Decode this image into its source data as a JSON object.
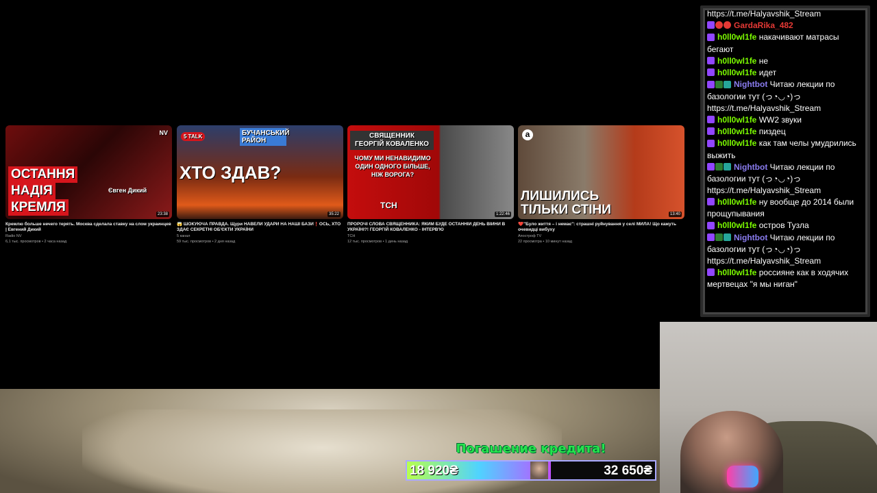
{
  "videos": [
    {
      "thumb_lines": [
        "ОСТАННЯ",
        "НАДІЯ",
        "КРЕМЛЯ"
      ],
      "thumb_badge": "NV",
      "thumb_name": "Євген Дикий",
      "duration": "23:38",
      "title": "Кремлю больше нечего терять. Москва сделала ставку на слом украинцев | Евгений Дикий",
      "channel": "Radio NV",
      "meta": "6,1 тыс. просмотров • 2 часа назад"
    },
    {
      "thumb_lines": [
        "ХТО ЗДАВ?"
      ],
      "thumb_badge": "5 TALK",
      "thumb_name": "БУЧАНСЬКИЙ РАЙОН",
      "duration": "35:22",
      "title": "😱 ШОКУЮЧА ПРАВДА. Щури НАВЕЛИ УДАРИ НА НАШІ БАЗИ❗ОСЬ, ХТО ЗДАЄ СЕКРЕТНІ ОБ'ЄКТИ УКРАЇНИ",
      "channel": "5 канал",
      "meta": "59 тыс. просмотров • 2 дня назад"
    },
    {
      "thumb_lines": [
        "СВЯЩЕННИК",
        "ГЕОРГІЙ КОВАЛЕНКО"
      ],
      "thumb_quote": "ЧОМУ МИ НЕНАВИДИМО ОДИН ОДНОГО БІЛЬШЕ, НІЖ ВОРОГА?",
      "thumb_badge": "ТСН",
      "duration": "1:22:46",
      "title": "ПРОРОЧІ СЛОВА СВЯЩЕННИКА: ЯКИМ БУДЕ ОСТАННІЙ ДЕНЬ ВІЙНИ В УКРАЇНІ?! ГЕОРГІЙ КОВАЛЕНКО - ІНТЕРВ'Ю",
      "channel": "ТСН",
      "meta": "12 тыс. просмотров • 1 день назад"
    },
    {
      "thumb_lines": [
        "ЛИШИЛИСЬ",
        "ТІЛЬКИ СТІНИ"
      ],
      "thumb_badge": "a",
      "duration": "13:40",
      "title": "❤️\"Було життя – і немає\": страшні руйнування у селі МИЛА! Що кажуть очевидці вибуху",
      "channel": "Апостроф TV",
      "meta": "22 просмотра • 10 минут назад"
    }
  ],
  "chat": [
    {
      "name": "",
      "text": "https://t.me/Halyavshik_Stream",
      "color": "white",
      "badges": []
    },
    {
      "name": "GardaRika_482",
      "text": "",
      "color": "red",
      "badges": [
        "twitch",
        "red",
        "red"
      ]
    },
    {
      "name": "h0ll0wl1fe",
      "text": "накачивают матрасы бегают",
      "color": "green",
      "badges": [
        "twitch"
      ]
    },
    {
      "name": "h0ll0wl1fe",
      "text": "не",
      "color": "green",
      "badges": [
        "twitch"
      ]
    },
    {
      "name": "h0ll0wl1fe",
      "text": "идет",
      "color": "green",
      "badges": [
        "twitch"
      ]
    },
    {
      "name": "Nightbot",
      "text": "Читаю лекции по базологии тут (っ◔◡◔)っ https://t.me/Halyavshik_Stream",
      "color": "purple",
      "badges": [
        "twitch",
        "green",
        "teal"
      ]
    },
    {
      "name": "h0ll0wl1fe",
      "text": "WW2 звуки",
      "color": "green",
      "badges": [
        "twitch"
      ]
    },
    {
      "name": "h0ll0wl1fe",
      "text": "пиздец",
      "color": "green",
      "badges": [
        "twitch"
      ]
    },
    {
      "name": "h0ll0wl1fe",
      "text": "как там челы умудрились выжить",
      "color": "green",
      "badges": [
        "twitch"
      ]
    },
    {
      "name": "Nightbot",
      "text": "Читаю лекции по базологии тут (っ◔◡◔)っ https://t.me/Halyavshik_Stream",
      "color": "purple",
      "badges": [
        "twitch",
        "green",
        "teal"
      ]
    },
    {
      "name": "h0ll0wl1fe",
      "text": "ну вообще до 2014 были прощупывания",
      "color": "green",
      "badges": [
        "twitch"
      ]
    },
    {
      "name": "h0ll0wl1fe",
      "text": "остров Тузла",
      "color": "green",
      "badges": [
        "twitch"
      ]
    },
    {
      "name": "Nightbot",
      "text": "Читаю лекции по базологии тут (っ◔◡◔)っ https://t.me/Halyavshik_Stream",
      "color": "purple",
      "badges": [
        "twitch",
        "green",
        "teal"
      ]
    },
    {
      "name": "h0ll0wl1fe",
      "text": "россияне как в ходячих мертвецах \"я мы ниган\"",
      "color": "green",
      "badges": [
        "twitch"
      ]
    }
  ],
  "goal": {
    "title": "Погашение кредита!",
    "current": "18 920₴",
    "target": "32 650₴",
    "progress": 0.58
  }
}
